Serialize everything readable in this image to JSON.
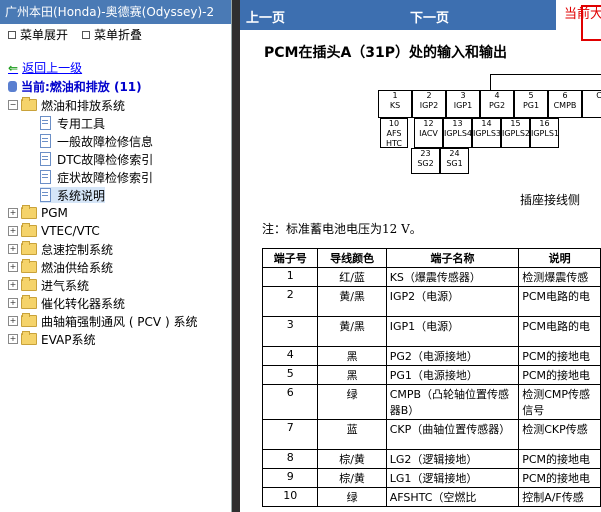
{
  "window": {
    "title": "广州本田(Honda)-奥德赛(Odyssey)-2"
  },
  "menu": {
    "expand": "菜单展开",
    "collapse": "菜单折叠"
  },
  "nav": {
    "back": "返回上一级",
    "current": "当前:燃油和排放 (11)"
  },
  "tree": [
    {
      "label": "燃油和排放系统",
      "type": "folder",
      "expanded": true
    },
    {
      "label": "专用工具",
      "type": "doc"
    },
    {
      "label": "一般故障检修信息",
      "type": "doc"
    },
    {
      "label": "DTC故障检修索引",
      "type": "doc"
    },
    {
      "label": "症状故障检修索引",
      "type": "doc"
    },
    {
      "label": "系统说明",
      "type": "doc",
      "selected": true
    },
    {
      "label": "PGM",
      "type": "folder"
    },
    {
      "label": "VTEC/VTC",
      "type": "folder"
    },
    {
      "label": "怠速控制系统",
      "type": "folder"
    },
    {
      "label": "燃油供给系统",
      "type": "folder"
    },
    {
      "label": "进气系统",
      "type": "folder"
    },
    {
      "label": "催化转化器系统",
      "type": "folder"
    },
    {
      "label": "曲轴箱强制通风 ( PCV ) 系统",
      "type": "folder"
    },
    {
      "label": "EVAP系统",
      "type": "folder"
    }
  ],
  "toolbar": {
    "prev": "上一页",
    "next": "下一页",
    "current": "当前大"
  },
  "doc": {
    "title": "PCM在插头A（31P）处的输入和输出",
    "connector_label": "插座接线侧",
    "note": "注：标准蓄电池电压为12 V。",
    "pins_top": [
      {
        "num": "1",
        "name": "KS"
      },
      {
        "num": "2",
        "name": "IGP2"
      },
      {
        "num": "3",
        "name": "IGP1"
      },
      {
        "num": "4",
        "name": "PG2"
      },
      {
        "num": "5",
        "name": "PG1"
      },
      {
        "num": "6",
        "name": "CMPB"
      },
      {
        "num": "",
        "name": "C"
      }
    ],
    "pins_mid": [
      {
        "num": "10",
        "name": "AFS HTC"
      },
      {
        "num": "12",
        "name": "IACV"
      },
      {
        "num": "13",
        "name": "IGPLS4"
      },
      {
        "num": "14",
        "name": "IGPLS3"
      },
      {
        "num": "15",
        "name": "IGPLS2"
      },
      {
        "num": "16",
        "name": "IGPLS1"
      }
    ],
    "pins_low": [
      {
        "num": "23",
        "name": "SG2"
      },
      {
        "num": "24",
        "name": "SG1"
      }
    ],
    "table_headers": [
      "端子号",
      "导线颜色",
      "端子名称",
      "说明"
    ],
    "rows": [
      [
        "1",
        "红/蓝",
        "KS（爆震传感器）",
        "检测爆震传感"
      ],
      [
        "2",
        "黄/黑",
        "IGP2（电源）",
        "PCM电路的电"
      ],
      [
        "3",
        "黄/黑",
        "IGP1（电源）",
        "PCM电路的电"
      ],
      [
        "4",
        "黑",
        "PG2（电源接地）",
        "PCM的接地电"
      ],
      [
        "5",
        "黑",
        "PG1（电源接地）",
        "PCM的接地电"
      ],
      [
        "6",
        "绿",
        "CMPB（凸轮轴位置传感器B）",
        "检测CMP传感信号"
      ],
      [
        "7",
        "蓝",
        "CKP（曲轴位置传感器）",
        "检测CKP传感"
      ],
      [
        "8",
        "棕/黄",
        "LG2（逻辑接地）",
        "PCM的接地电"
      ],
      [
        "9",
        "棕/黄",
        "LG1（逻辑接地）",
        "PCM的接地电"
      ],
      [
        "10",
        "绿",
        "AFSHTC（空燃比",
        "控制A/F传感"
      ]
    ]
  }
}
